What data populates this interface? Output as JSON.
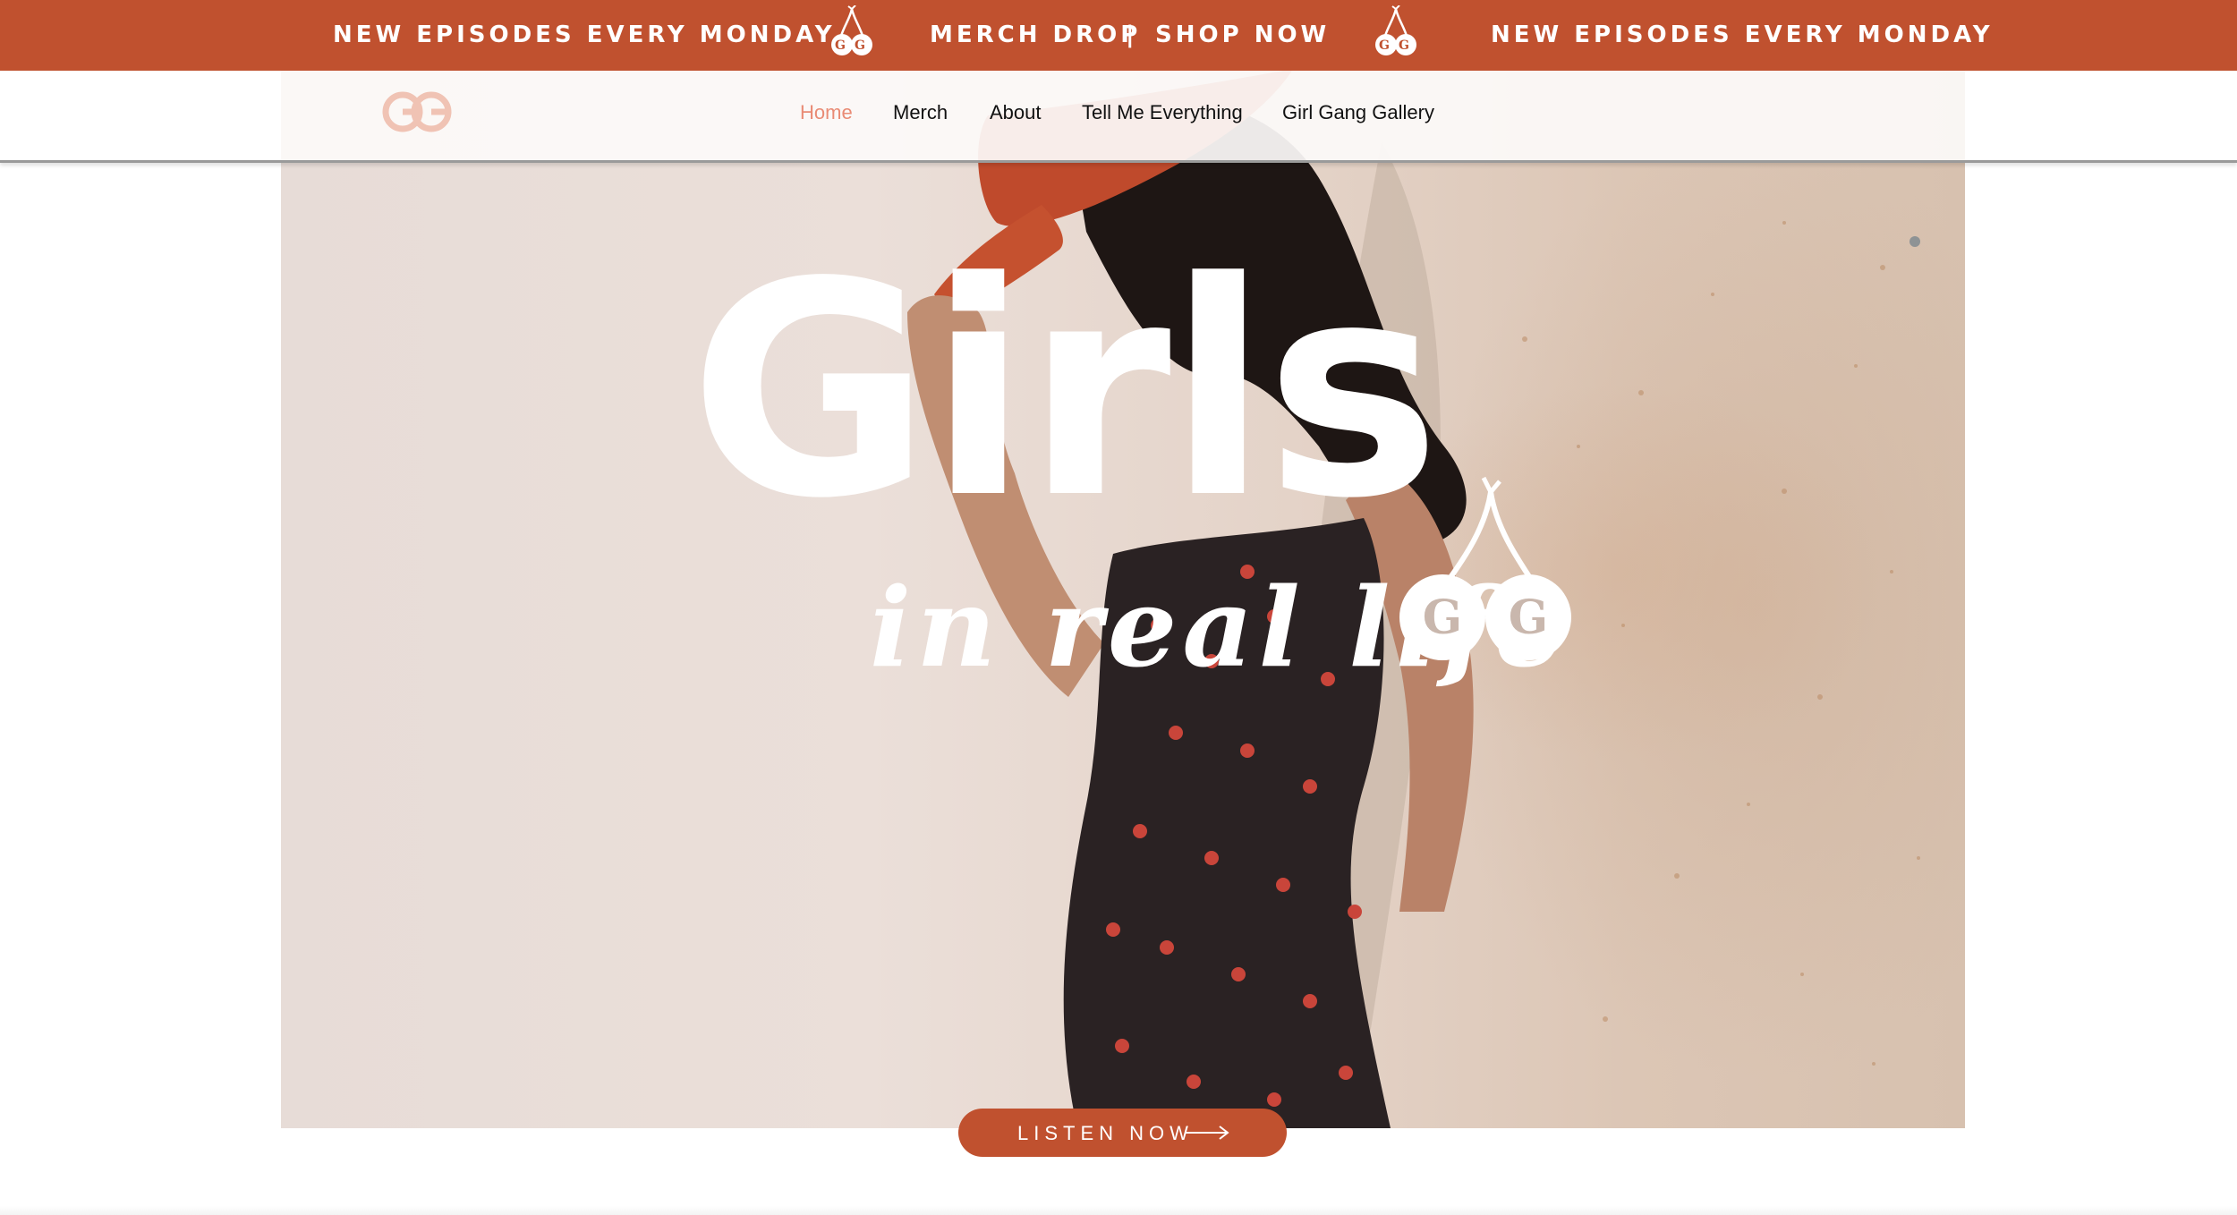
{
  "banner": {
    "left_text": "NEW EPISODES EVERY MONDAY",
    "merch_text": "MERCH DROP",
    "separator": "|",
    "shop_text": "SHOP NOW",
    "right_text": "NEW EPISODES EVERY MONDAY",
    "icon": "cherry-gg-icon",
    "background_color": "#c0512f",
    "text_color": "#ffffff"
  },
  "nav": {
    "logo": "gg-logo",
    "items": [
      {
        "label": "Home",
        "active": true
      },
      {
        "label": "Merch",
        "active": false
      },
      {
        "label": "About",
        "active": false
      },
      {
        "label": "Tell Me Everything",
        "active": false
      },
      {
        "label": "Girl Gang Gallery",
        "active": false
      }
    ],
    "active_color": "#e98b75",
    "text_color": "#111111"
  },
  "hero": {
    "title": "Girls",
    "subtitle": "in real life",
    "cherry_logo_text": "GG",
    "image": "woman-in-red-hat-and-cherry-print-dress"
  },
  "cta": {
    "label": "LISTEN NOW",
    "icon": "arrow-right-icon",
    "color": "#c0512f"
  }
}
